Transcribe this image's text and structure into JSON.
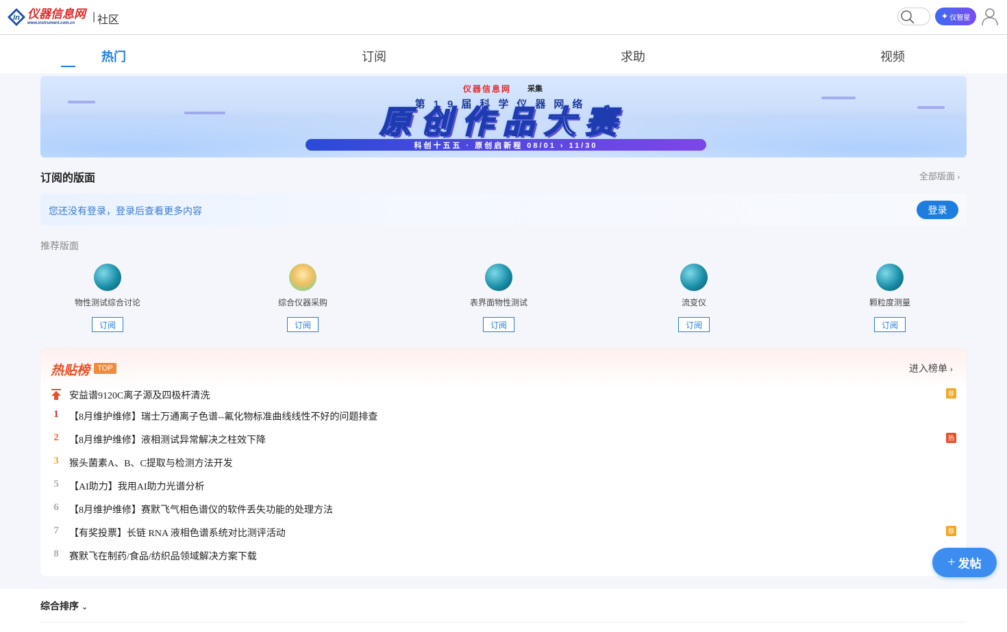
{
  "header": {
    "logo_cn": "仪器信息网",
    "logo_url": "www.instrument.com.cn",
    "separator": "|",
    "section": "社区",
    "ai_label": "仪智星"
  },
  "tabs": [
    {
      "label": "热门",
      "active": true
    },
    {
      "label": "订阅",
      "active": false
    },
    {
      "label": "求助",
      "active": false
    },
    {
      "label": "视频",
      "active": false
    }
  ],
  "banner": {
    "org": "仪器信息网",
    "partner": "采集",
    "subtitle": "第19届科学仪器网络",
    "title": "原创作品大赛",
    "bar": "科创十五五 · 原创启新程 08/01 › 11/30"
  },
  "subscribed": {
    "title": "订阅的版面",
    "all_link": "全部版面",
    "login_hint": "您还没有登录，登录后查看更多内容",
    "login_button": "登录"
  },
  "recommended": {
    "title": "推荐版面",
    "subscribe_label": "订阅",
    "boards": [
      {
        "name": "物性测试综合讨论"
      },
      {
        "name": "综合仪器采购"
      },
      {
        "name": "表界面物性测试"
      },
      {
        "name": "流变仪"
      },
      {
        "name": "颗粒度测量"
      }
    ]
  },
  "hot_list": {
    "title": "热贴榜",
    "badge": "TOP",
    "enter_link": "进入榜单",
    "items": [
      {
        "rank": "",
        "title": "安益谱9120C离子源及四极杆清洗",
        "tag": "荐"
      },
      {
        "rank": "1",
        "title": "【8月维护维修】瑞士万通离子色谱--氟化物标准曲线线性不好的问题排查",
        "tag": ""
      },
      {
        "rank": "2",
        "title": "【8月维护维修】液相测试异常解决之柱效下降",
        "tag": "热"
      },
      {
        "rank": "3",
        "title": "猴头菌素A、B、C提取与检测方法开发",
        "tag": ""
      },
      {
        "rank": "5",
        "title": "【AI助力】我用AI助力光谱分析",
        "tag": ""
      },
      {
        "rank": "6",
        "title": "【8月维护维修】赛默飞气相色谱仪的软件丢失功能的处理方法",
        "tag": ""
      },
      {
        "rank": "7",
        "title": "【有奖投票】长链 RNA 液相色谱系统对比测评活动",
        "tag": "荐"
      },
      {
        "rank": "8",
        "title": "赛默飞在制药/食品/纺织品领域解决方案下载",
        "tag": ""
      }
    ]
  },
  "post_button": "发帖",
  "sort": {
    "label": "综合排序"
  },
  "colors": {
    "accent": "#1e7ee0",
    "hot": "#e8512a",
    "logo_red": "#e02b2b"
  }
}
